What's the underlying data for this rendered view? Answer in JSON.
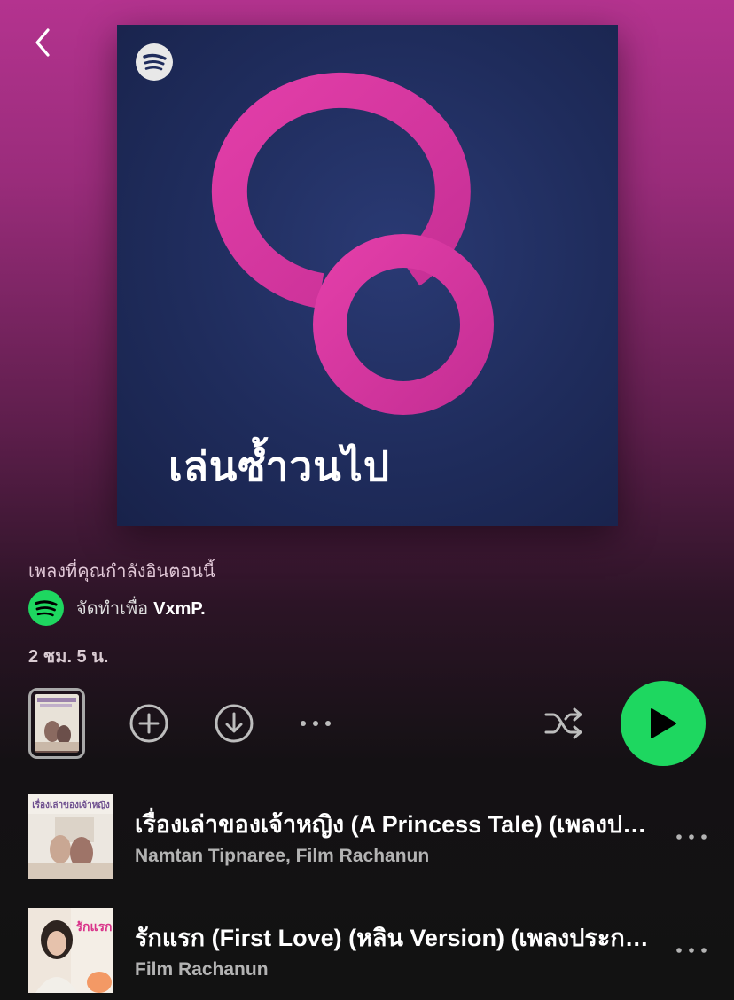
{
  "nav": {
    "back_icon": "chevron-left-icon"
  },
  "cover": {
    "title": "เล่นซ้ำวนไป",
    "brand_icon": "spotify-logo-icon",
    "accent": "#e040a6",
    "background": "#1f2c5c"
  },
  "playlist": {
    "description": "เพลงที่คุณกำลังอินตอนนี้",
    "made_for_label": "จัดทำเพื่อ",
    "user": "VxmP.",
    "duration": "2 ชม. 5 น."
  },
  "controls": {
    "preview_icon": "preview-thumbnail",
    "add_icon": "plus-circle-icon",
    "download_icon": "download-circle-icon",
    "more_icon": "more-dots-icon",
    "shuffle_icon": "shuffle-icon",
    "play_icon": "play-icon",
    "play_color": "#1ed760"
  },
  "tracks": [
    {
      "title": "เรื่องเล่าของเจ้าหญิง (A Princess Tale) (เพลงประกอบซีรีส์ ปิ่นภักดิ์)",
      "artist": "Namtan Tipnaree, Film Rachanun",
      "art_text": "เรื่องเล่าของเจ้าหญิง"
    },
    {
      "title": "รักแรก (First Love) (หลิน Version) (เพลงประกอบซีรีส์ ปิ่นภักดิ์)",
      "artist": "Film Rachanun",
      "art_text": "รักแรก"
    }
  ]
}
